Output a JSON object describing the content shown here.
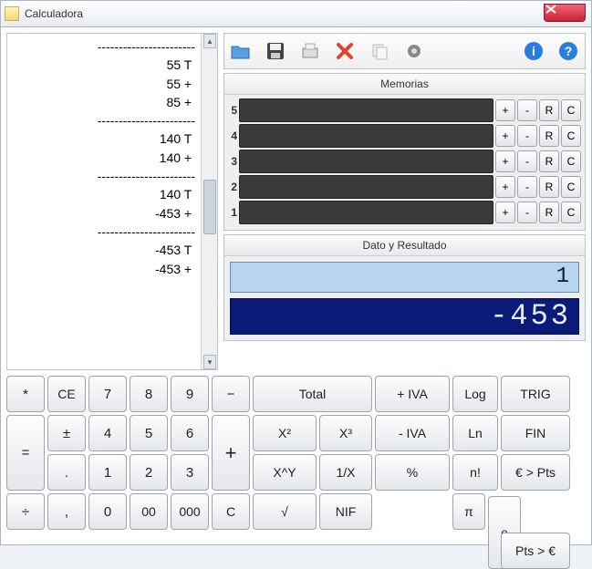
{
  "window": {
    "title": "Calculadora"
  },
  "tape": [
    "-----------------------",
    "              55 T ",
    "",
    "",
    "              55 + ",
    "              85 + ",
    "-----------------------",
    "             140 T ",
    "",
    "",
    "             140 + ",
    "-----------------------",
    "             140 T ",
    "",
    "",
    "            -453 + ",
    "-----------------------",
    "            -453 T ",
    "",
    "",
    "            -453 + "
  ],
  "toolbar_icons": [
    "open",
    "save",
    "tape",
    "delete",
    "copy",
    "gear",
    "info",
    "help"
  ],
  "sections": {
    "memorias": "Memorias",
    "dato_resultado": "Dato y Resultado"
  },
  "memory_slots": [
    5,
    4,
    3,
    2,
    1
  ],
  "memory_buttons": {
    "add": "+",
    "sub": "-",
    "recall": "R",
    "clear": "C"
  },
  "display": {
    "input": "1",
    "result": "-453"
  },
  "keypad": {
    "star": "*",
    "ce": "CE",
    "k7": "7",
    "k8": "8",
    "k9": "9",
    "minus": "−",
    "total": "Total",
    "plus_iva": "+ IVA",
    "log": "Log",
    "trig": "TRIG",
    "eq": "=",
    "pm": "±",
    "k4": "4",
    "k5": "5",
    "k6": "6",
    "x2": "X²",
    "x3": "X³",
    "minus_iva": "- IVA",
    "ln": "Ln",
    "fin": "FIN",
    "dot": ".",
    "k1": "1",
    "k2": "2",
    "k3": "3",
    "plus": "+",
    "xy": "X^Y",
    "inv": "1/X",
    "pct": "%",
    "nfact": "n!",
    "eur_pts": "€ > Pts",
    "div": "÷",
    "kcomma": ",",
    "k0": "0",
    "k00": "00",
    "k000": "000",
    "c": "C",
    "sqrt": "√",
    "nif": "NIF",
    "pi": "π",
    "e": "e",
    "pts_eur": "Pts > €"
  }
}
